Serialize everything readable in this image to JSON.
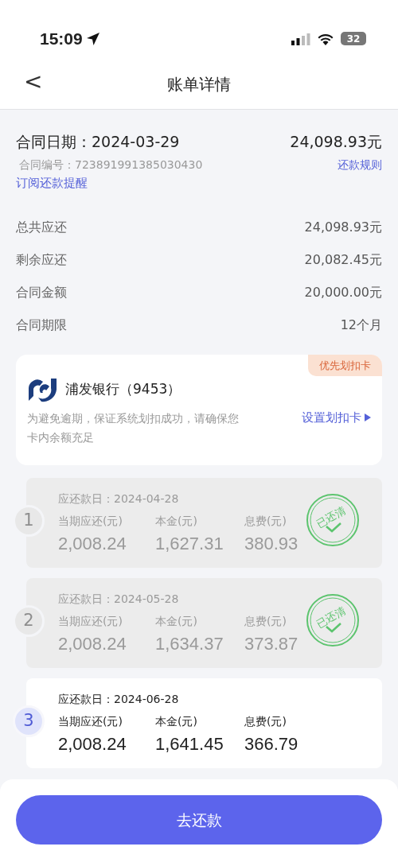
{
  "status_bar": {
    "time": "15:09",
    "battery": "32"
  },
  "header": {
    "back": "<",
    "title": "账单详情"
  },
  "contract": {
    "date_label": "合同日期：",
    "date": "2024-03-29",
    "amount": "24,098.93元",
    "number_label": "合同编号：",
    "number": "723891991385030430",
    "rules_link": "还款规则",
    "subscribe_link": "订阅还款提醒"
  },
  "summary": [
    {
      "label": "总共应还",
      "value": "24,098.93元"
    },
    {
      "label": "剩余应还",
      "value": "20,082.45元"
    },
    {
      "label": "合同金额",
      "value": "20,000.00元"
    },
    {
      "label": "合同期限",
      "value": "12个月"
    }
  ],
  "bank_card": {
    "tag": "优先划扣卡",
    "name": "浦发银行（9453）",
    "note": "为避免逾期，保证系统划扣成功，请确保您卡内余额充足",
    "action": "设置划扣卡"
  },
  "installments": [
    {
      "index": "1",
      "due_label": "应还款日：",
      "due_date": "2024-04-28",
      "paid": true,
      "stamp": "已还清",
      "columns": [
        {
          "label": "当期应还(元)",
          "value": "2,008.24"
        },
        {
          "label": "本金(元)",
          "value": "1,627.31"
        },
        {
          "label": "息费(元)",
          "value": "380.93"
        }
      ]
    },
    {
      "index": "2",
      "due_label": "应还款日：",
      "due_date": "2024-05-28",
      "paid": true,
      "stamp": "已还清",
      "columns": [
        {
          "label": "当期应还(元)",
          "value": "2,008.24"
        },
        {
          "label": "本金(元)",
          "value": "1,634.37"
        },
        {
          "label": "息费(元)",
          "value": "373.87"
        }
      ]
    },
    {
      "index": "3",
      "due_label": "应还款日：",
      "due_date": "2024-06-28",
      "paid": false,
      "columns": [
        {
          "label": "当期应还(元)",
          "value": "2,008.24"
        },
        {
          "label": "本金(元)",
          "value": "1,641.45"
        },
        {
          "label": "息费(元)",
          "value": "366.79"
        }
      ]
    }
  ],
  "pay_button": "去还款"
}
